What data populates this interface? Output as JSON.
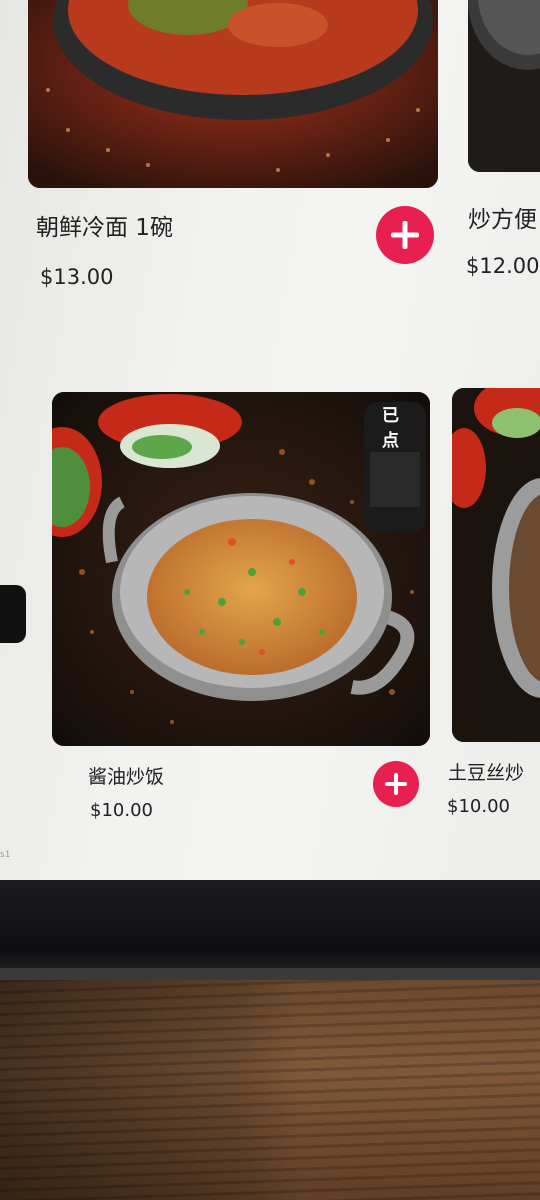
{
  "menu": {
    "items": [
      {
        "name": "朝鲜冷面 1碗",
        "price": "$13.00"
      },
      {
        "name": "炒方便",
        "price": "$12.00"
      },
      {
        "name": "酱油炒饭",
        "price": "$10.00",
        "badge": "已点"
      },
      {
        "name": "土豆丝炒",
        "price": "$10.00"
      }
    ]
  },
  "colors": {
    "add_button": "#e8204f",
    "screen": "#f2f2f0"
  },
  "icons": {
    "add": "plus-icon"
  }
}
